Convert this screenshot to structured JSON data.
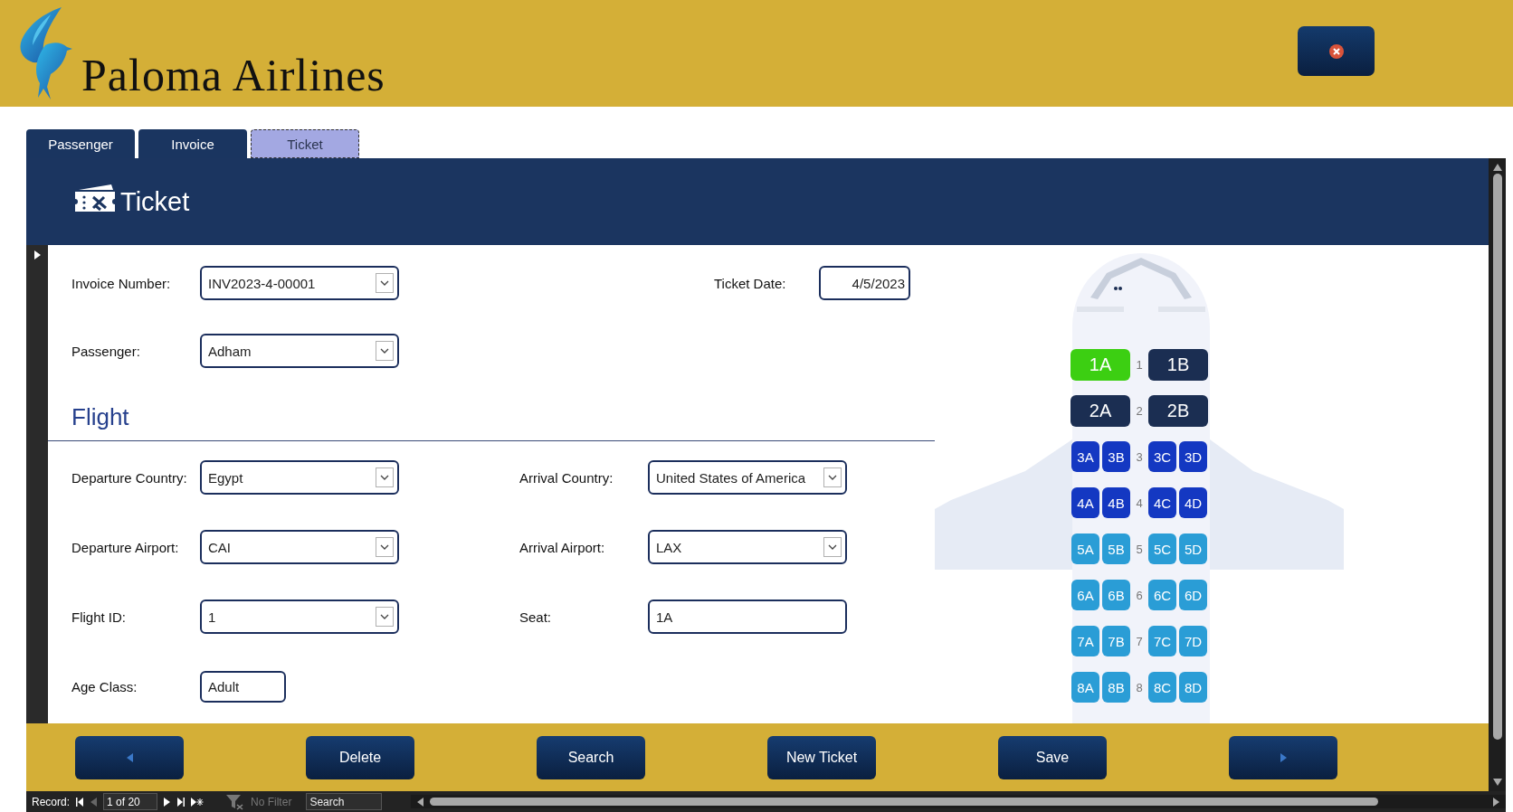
{
  "header": {
    "logo_text": "Paloma Airlines"
  },
  "tabs": [
    {
      "label": "Passenger",
      "selected": false
    },
    {
      "label": "Invoice",
      "selected": false
    },
    {
      "label": "Ticket",
      "selected": true
    }
  ],
  "form": {
    "title": "Ticket",
    "fields": [
      {
        "label": "Invoice Number:",
        "value": "INV2023-4-00001",
        "kind": "combo"
      },
      {
        "label": "Ticket Date:",
        "value": "4/5/2023",
        "kind": "date"
      },
      {
        "label": "Passenger:",
        "value": "Adham",
        "kind": "combo"
      }
    ],
    "section_title": "Flight",
    "flight_fields": [
      {
        "label": "Departure Country:",
        "value": "Egypt",
        "kind": "combo"
      },
      {
        "label": "Arrival Country:",
        "value": "United States of America",
        "kind": "combo"
      },
      {
        "label": "Departure Airport:",
        "value": "CAI",
        "kind": "combo"
      },
      {
        "label": "Arrival Airport:",
        "value": "LAX",
        "kind": "combo"
      },
      {
        "label": "Flight ID:",
        "value": "1",
        "kind": "combo"
      },
      {
        "label": "Seat:",
        "value": "1A",
        "kind": "text"
      },
      {
        "label": "Age Class:",
        "value": "Adult",
        "kind": "short"
      }
    ]
  },
  "seat_map": {
    "rows": [
      {
        "number": "1",
        "color": "#1b2e52",
        "seats": [
          {
            "label": "1A",
            "selected": true
          },
          {
            "label": "1B",
            "selected": false
          }
        ]
      },
      {
        "number": "2",
        "color": "#1b2e52",
        "seats": [
          {
            "label": "2A",
            "selected": false
          },
          {
            "label": "2B",
            "selected": false
          }
        ]
      },
      {
        "number": "3",
        "color": "#1438c2",
        "seats": [
          {
            "label": "3A",
            "selected": false
          },
          {
            "label": "3B",
            "selected": false
          },
          {
            "label": "3C",
            "selected": false
          },
          {
            "label": "3D",
            "selected": false
          }
        ]
      },
      {
        "number": "4",
        "color": "#1438c2",
        "seats": [
          {
            "label": "4A",
            "selected": false
          },
          {
            "label": "4B",
            "selected": false
          },
          {
            "label": "4C",
            "selected": false
          },
          {
            "label": "4D",
            "selected": false
          }
        ]
      },
      {
        "number": "5",
        "color": "#2a9dd6",
        "seats": [
          {
            "label": "5A",
            "selected": false
          },
          {
            "label": "5B",
            "selected": false
          },
          {
            "label": "5C",
            "selected": false
          },
          {
            "label": "5D",
            "selected": false
          }
        ]
      },
      {
        "number": "6",
        "color": "#2a9dd6",
        "seats": [
          {
            "label": "6A",
            "selected": false
          },
          {
            "label": "6B",
            "selected": false
          },
          {
            "label": "6C",
            "selected": false
          },
          {
            "label": "6D",
            "selected": false
          }
        ]
      },
      {
        "number": "7",
        "color": "#2a9dd6",
        "seats": [
          {
            "label": "7A",
            "selected": false
          },
          {
            "label": "7B",
            "selected": false
          },
          {
            "label": "7C",
            "selected": false
          },
          {
            "label": "7D",
            "selected": false
          }
        ]
      },
      {
        "number": "8",
        "color": "#2a9dd6",
        "seats": [
          {
            "label": "8A",
            "selected": false
          },
          {
            "label": "8B",
            "selected": false
          },
          {
            "label": "8C",
            "selected": false
          },
          {
            "label": "8D",
            "selected": false
          }
        ]
      }
    ]
  },
  "actions": [
    {
      "kind": "previous"
    },
    {
      "kind": "text",
      "label": "Delete"
    },
    {
      "kind": "text",
      "label": "Search"
    },
    {
      "kind": "text",
      "label": "New Ticket"
    },
    {
      "kind": "text",
      "label": "Save"
    },
    {
      "kind": "next"
    }
  ],
  "record_nav": {
    "label": "Record:",
    "position": "1 of 20",
    "filter": "No Filter",
    "search_placeholder": "Search"
  }
}
